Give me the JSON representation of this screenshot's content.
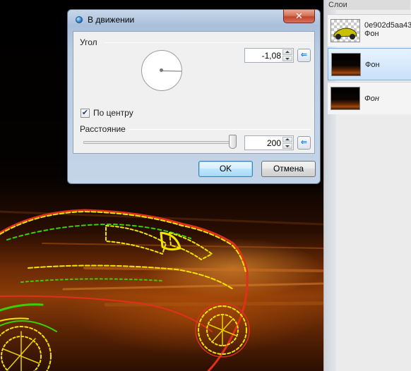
{
  "dialog": {
    "title": "В движении",
    "close_label": "✕",
    "angle": {
      "label": "Угол",
      "value": "-1,08",
      "dial_angle_degrees": -1.08
    },
    "center_checkbox": {
      "label": "По центру",
      "checked": true,
      "check_glyph": "✔"
    },
    "distance": {
      "label": "Расстояние",
      "value": "200",
      "slider_fraction": 1.0
    },
    "reset_glyph": "⇐",
    "ok_label": "OK",
    "cancel_label": "Отмена"
  },
  "layers_panel": {
    "title": "Слои",
    "items": [
      {
        "name": "0e902d5aa43",
        "sub": "Фон",
        "thumb": "car-outline-checker",
        "selected": false,
        "italic": false
      },
      {
        "name": "Фон",
        "sub": "",
        "thumb": "dark-road",
        "selected": true,
        "italic": false
      },
      {
        "name": "Фон",
        "sub": "",
        "thumb": "dark-road",
        "selected": false,
        "italic": true
      }
    ]
  },
  "colors": {
    "accent": "#3c7fb1",
    "selection": "#c9e1fa",
    "close_button": "#c2452b",
    "neon_yellow": "#f2e400",
    "neon_green": "#3ad000",
    "neon_red": "#e0301a"
  }
}
